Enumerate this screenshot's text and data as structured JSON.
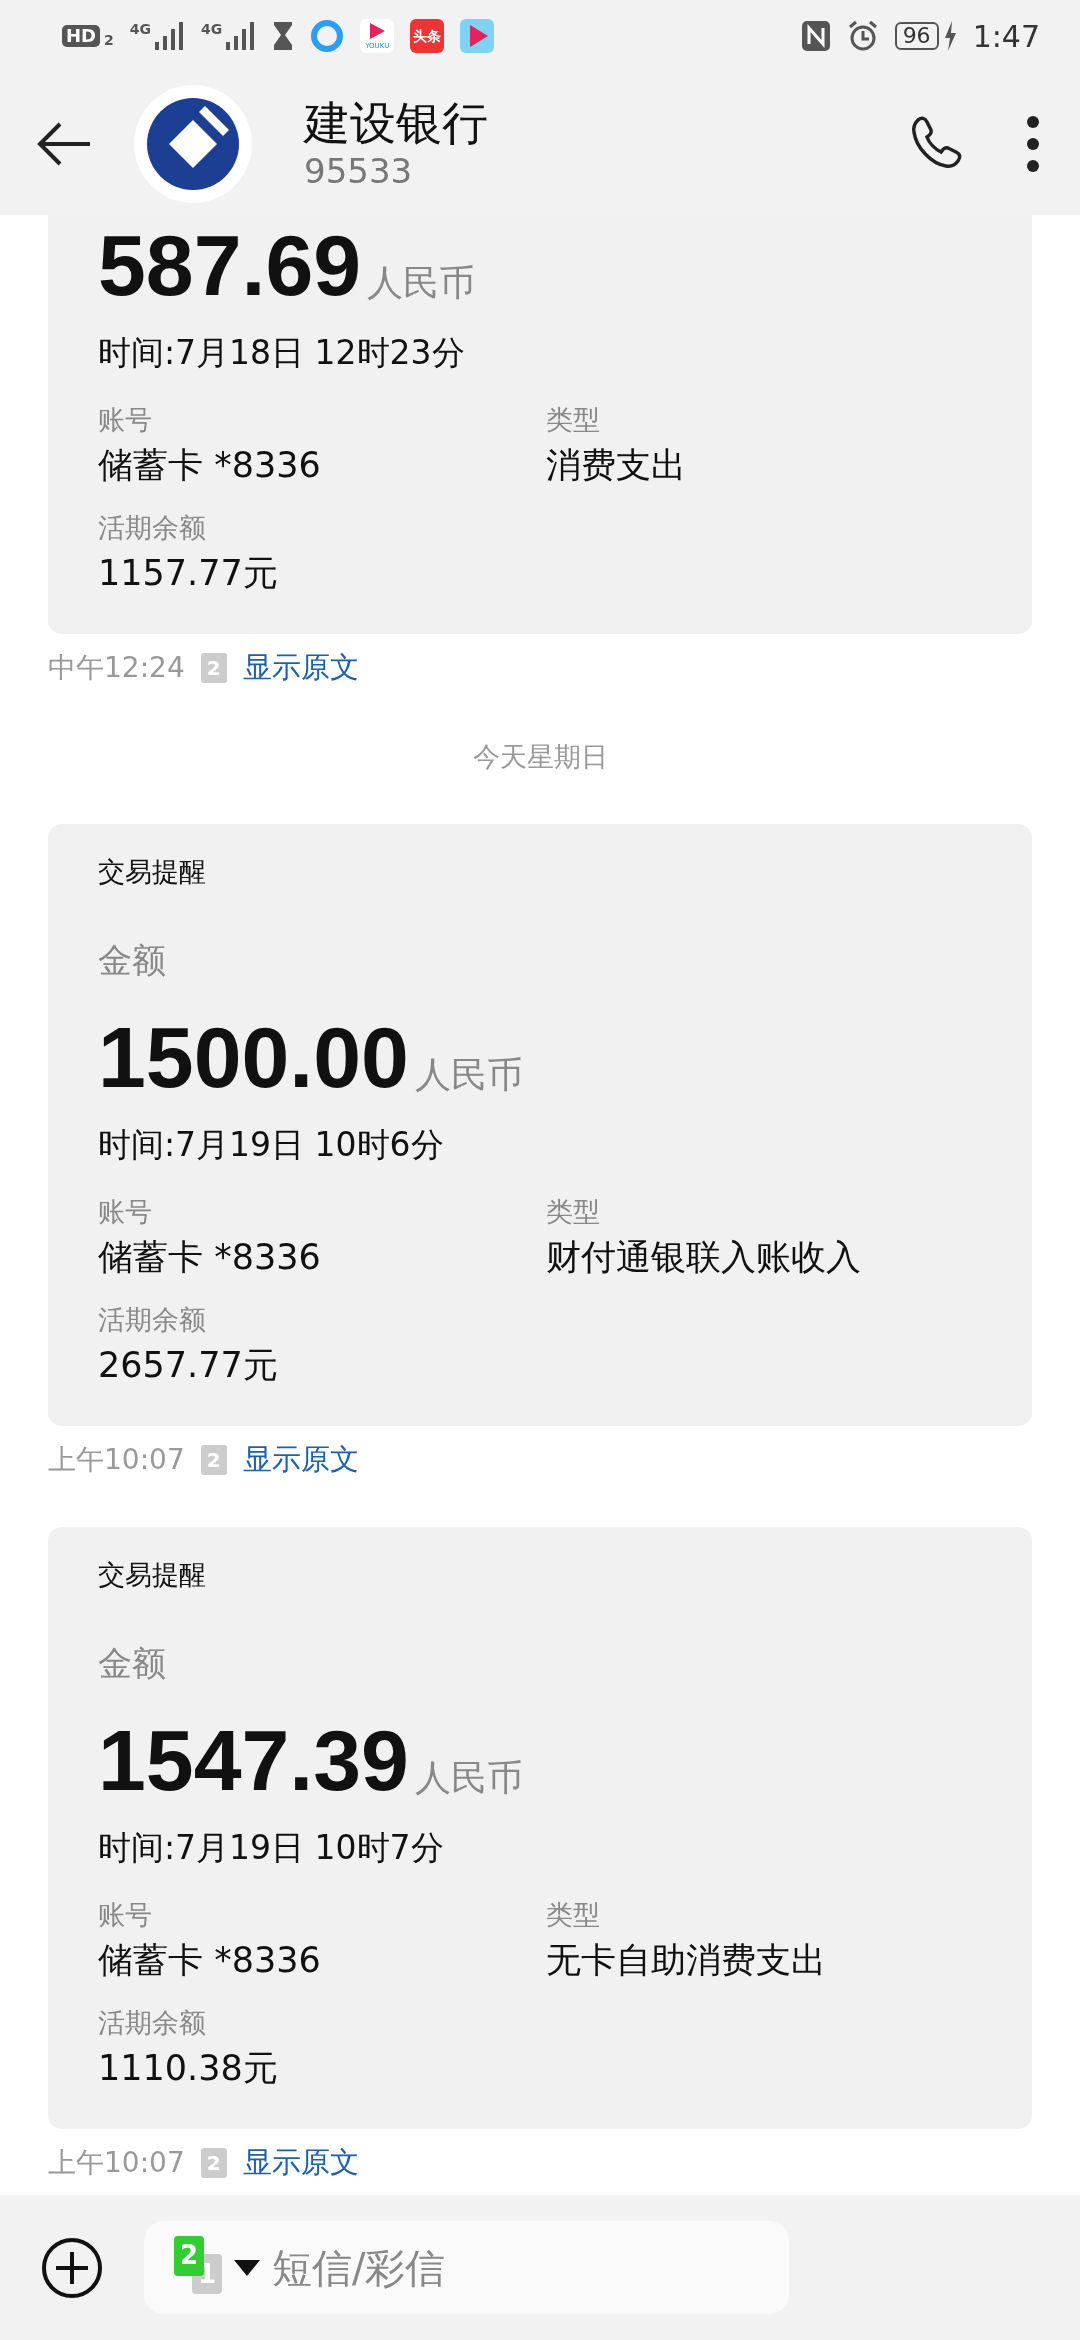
{
  "status_bar": {
    "hd": "HD",
    "hd_sim": "2",
    "network_1": "4G",
    "network_2": "4G",
    "toutiao": "头条",
    "youku": "YOUKU",
    "battery": "96",
    "time": "1:47"
  },
  "header": {
    "title": "建设银行",
    "subtitle": "95533"
  },
  "messages": [
    {
      "kind": "transaction",
      "cut_top": true,
      "amount": "587.69",
      "currency": "人民币",
      "time": "时间:7月18日 12时23分",
      "account_label": "账号",
      "account": "储蓄卡 *8336",
      "type_label": "类型",
      "type": "消费支出",
      "balance_label": "活期余额",
      "balance": "1157.77元",
      "sent": "中午12:24",
      "sim": "2",
      "show_original": "显示原文"
    },
    {
      "kind": "date_divider",
      "text": "今天星期日"
    },
    {
      "kind": "transaction",
      "cut_top": false,
      "heading": "交易提醒",
      "amount_label": "金额",
      "amount": "1500.00",
      "currency": "人民币",
      "time": "时间:7月19日 10时6分",
      "account_label": "账号",
      "account": "储蓄卡 *8336",
      "type_label": "类型",
      "type": "财付通银联入账收入",
      "balance_label": "活期余额",
      "balance": "2657.77元",
      "sent": "上午10:07",
      "sim": "2",
      "show_original": "显示原文"
    },
    {
      "kind": "transaction",
      "cut_top": false,
      "heading": "交易提醒",
      "amount_label": "金额",
      "amount": "1547.39",
      "currency": "人民币",
      "time": "时间:7月19日 10时7分",
      "account_label": "账号",
      "account": "储蓄卡 *8336",
      "type_label": "类型",
      "type": "无卡自助消费支出",
      "balance_label": "活期余额",
      "balance": "1110.38元",
      "sent": "上午10:07",
      "sim": "2",
      "show_original": "显示原文"
    }
  ],
  "composer": {
    "sim_active": "2",
    "sim_other": "1",
    "placeholder": "短信/彩信"
  }
}
